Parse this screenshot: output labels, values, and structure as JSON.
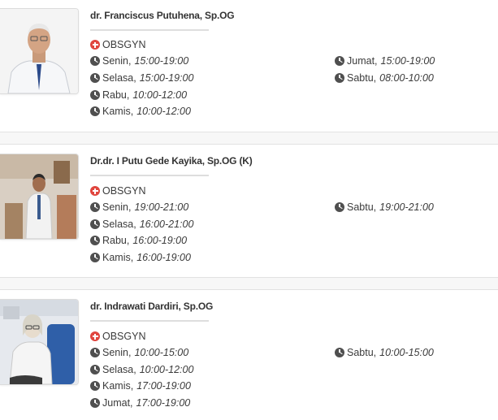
{
  "doctors": [
    {
      "name": "dr. Franciscus Putuhena, Sp.OG",
      "specialty": "OBSGYN",
      "photo_bg": "#f2f2f2",
      "schedule_left": [
        {
          "day": "Senin,",
          "time": "15:00-19:00"
        },
        {
          "day": "Selasa,",
          "time": "15:00-19:00"
        },
        {
          "day": "Rabu,",
          "time": "10:00-12:00"
        },
        {
          "day": "Kamis,",
          "time": "10:00-12:00"
        }
      ],
      "schedule_right": [
        {
          "day": "Jumat,",
          "time": "15:00-19:00"
        },
        {
          "day": "Sabtu,",
          "time": "08:00-10:00"
        }
      ]
    },
    {
      "name": "Dr.dr. I Putu Gede Kayika, Sp.OG (K)",
      "specialty": "OBSGYN",
      "photo_bg": "#d9cfc3",
      "schedule_left": [
        {
          "day": "Senin,",
          "time": "19:00-21:00"
        },
        {
          "day": "Selasa,",
          "time": "16:00-21:00"
        },
        {
          "day": "Rabu,",
          "time": "16:00-19:00"
        },
        {
          "day": "Kamis,",
          "time": "16:00-19:00"
        }
      ],
      "schedule_right": [
        {
          "day": "Sabtu,",
          "time": "19:00-21:00"
        }
      ]
    },
    {
      "name": "dr. Indrawati Dardiri, Sp.OG",
      "specialty": "OBSGYN",
      "photo_bg": "#e6e9ee",
      "schedule_left": [
        {
          "day": "Senin,",
          "time": "10:00-15:00"
        },
        {
          "day": "Selasa,",
          "time": "10:00-12:00"
        },
        {
          "day": "Kamis,",
          "time": "17:00-19:00"
        },
        {
          "day": "Jumat,",
          "time": "17:00-19:00"
        }
      ],
      "schedule_right": [
        {
          "day": "Sabtu,",
          "time": "10:00-15:00"
        }
      ]
    }
  ],
  "colors": {
    "specialty_icon": "#e0453e",
    "clock_icon": "#4f4f4f",
    "divider": "#dedede"
  }
}
